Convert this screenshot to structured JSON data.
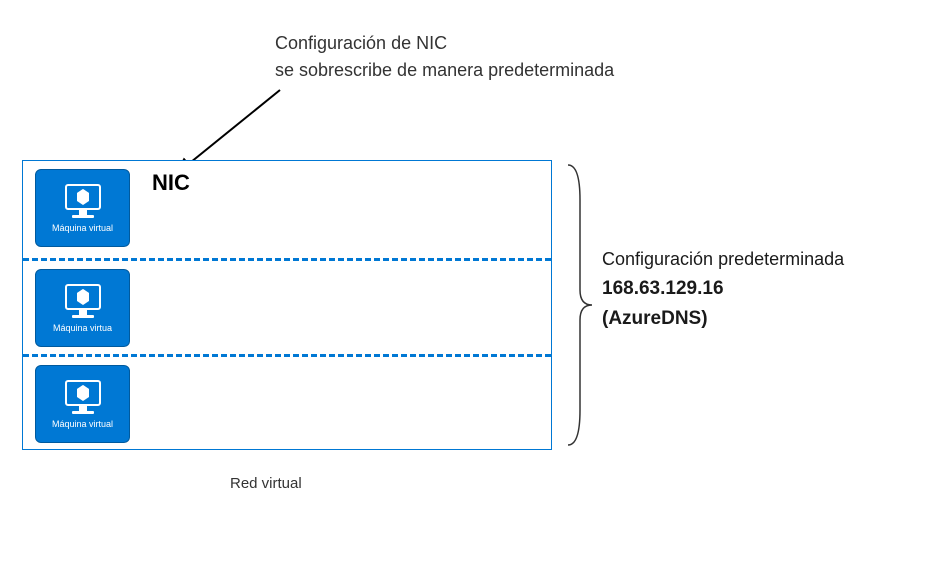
{
  "annotation": {
    "line1": "Configuración de NIC",
    "line2": "se sobrescribe de manera predeterminada"
  },
  "vnet": {
    "caption": "Red virtual",
    "subnets": [
      {
        "vm_label": "Máquina virtual",
        "nic_label": "NIC"
      },
      {
        "vm_label": "Máquina virtua"
      },
      {
        "vm_label": "Máquina virtual"
      }
    ]
  },
  "default_config": {
    "title": "Configuración predeterminada",
    "ip": "168.63.129.16",
    "service": "(AzureDNS)"
  },
  "colors": {
    "azure_blue": "#0078d4"
  }
}
